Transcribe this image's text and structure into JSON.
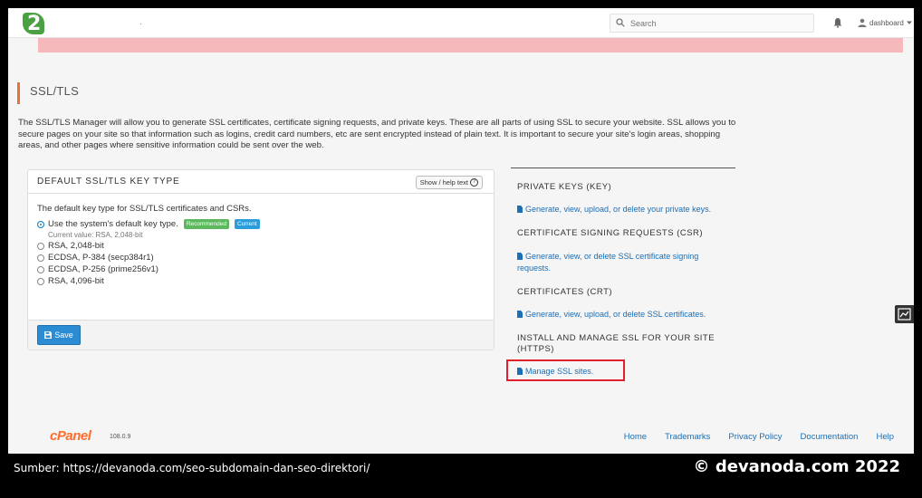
{
  "header": {
    "search_placeholder": "Search",
    "username": "dashboard",
    "dot": "."
  },
  "page": {
    "title": "SSL/TLS",
    "intro": "The SSL/TLS Manager will allow you to generate SSL certificates, certificate signing requests, and private keys. These are all parts of using SSL to secure your website. SSL allows you to secure pages on your site so that information such as logins, credit card numbers, etc are sent encrypted instead of plain text. It is important to secure your site's login areas, shopping areas, and other pages where sensitive information could be sent over the web."
  },
  "panel": {
    "title": "DEFAULT SSL/TLS KEY TYPE",
    "help_label": "Show / help text",
    "description": "The default key type for SSL/TLS certificates and CSRs.",
    "options": [
      {
        "label": "Use the system's default key type."
      },
      {
        "label": "RSA, 2,048-bit"
      },
      {
        "label": "ECDSA, P-384 (secp384r1)"
      },
      {
        "label": "ECDSA, P-256 (prime256v1)"
      },
      {
        "label": "RSA, 4,096-bit"
      }
    ],
    "badge_recommended": "Recommended",
    "badge_current": "Current",
    "current_value": "Current value: RSA, 2,048-bit",
    "save_label": "Save"
  },
  "sections": [
    {
      "title": "PRIVATE KEYS (KEY)",
      "link": "Generate, view, upload, or delete your private keys."
    },
    {
      "title": "CERTIFICATE SIGNING REQUESTS (CSR)",
      "link": "Generate, view, or delete SSL certificate signing requests."
    },
    {
      "title": "CERTIFICATES (CRT)",
      "link": "Generate, view, upload, or delete SSL certificates."
    },
    {
      "title": "INSTALL AND MANAGE SSL FOR YOUR SITE (HTTPS)",
      "link": "Manage SSL sites."
    }
  ],
  "footer": {
    "logo": "cPanel",
    "version": "108.0.9",
    "links": [
      "Home",
      "Trademarks",
      "Privacy Policy",
      "Documentation",
      "Help"
    ]
  },
  "caption": {
    "source": "Sumber:  https://devanoda.com/seo-subdomain-dan-seo-direktori/",
    "copyright": "© devanoda.com 2022"
  },
  "colors": {
    "accent": "#e8703a",
    "link": "#1b6fb5",
    "button": "#2b8cd4",
    "alert": "#f5b9bb",
    "highlight": "#e0202a"
  }
}
